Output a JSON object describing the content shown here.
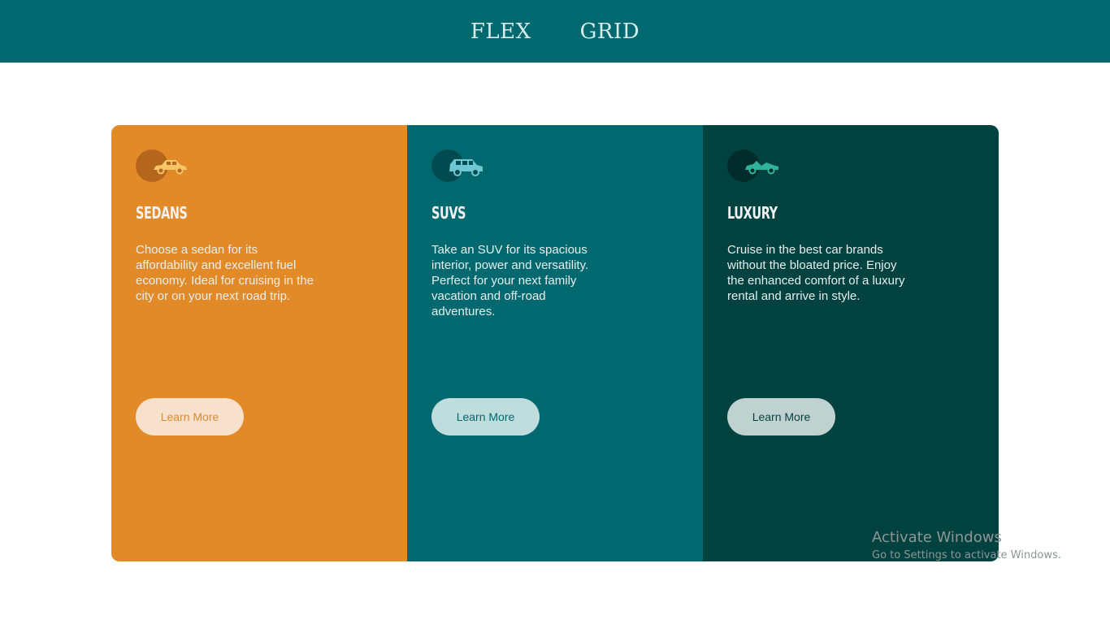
{
  "nav": {
    "items": [
      {
        "label": "FLEX"
      },
      {
        "label": "GRID"
      }
    ]
  },
  "cards": [
    {
      "title": "SEDANS",
      "description": "Choose a sedan for its affordability and excellent fuel economy. Ideal for cruising in the city or on your next road trip.",
      "button": "Learn More",
      "icon": "sedan-car-icon",
      "color": "#e28928"
    },
    {
      "title": "SUVS",
      "description": "Take an SUV for its spacious interior, power and versatility. Perfect for your next family vacation and off-road adventures.",
      "button": "Learn More",
      "icon": "suv-car-icon",
      "color": "#006970"
    },
    {
      "title": "LUXURY",
      "description": "Cruise in the best car brands without the bloated price. Enjoy the enhanced comfort of a luxury rental and arrive in style.",
      "button": "Learn More",
      "icon": "luxury-car-icon",
      "color": "#004240"
    }
  ],
  "watermark": {
    "title": "Activate Windows",
    "subtitle": "Go to Settings to activate Windows."
  }
}
